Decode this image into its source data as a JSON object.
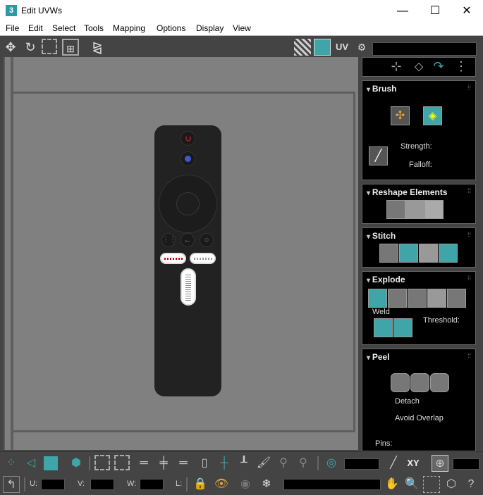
{
  "window": {
    "icon_text": "3",
    "title": "Edit UVWs",
    "minimize": "—",
    "maximize": "☐",
    "close": "✕"
  },
  "menu": [
    "File",
    "Edit",
    "Select",
    "Tools",
    "Mapping",
    "Options",
    "Display",
    "View"
  ],
  "toolbar": {
    "uv_label": "UV",
    "uv_value": ""
  },
  "panel": {
    "brush": {
      "title": "Brush",
      "strength_label": "Strength:",
      "falloff_label": "Falloff:"
    },
    "reshape": {
      "title": "Reshape Elements"
    },
    "stitch": {
      "title": "Stitch"
    },
    "explode": {
      "title": "Explode",
      "weld_label": "Weld",
      "threshold_label": "Threshold:"
    },
    "peel": {
      "title": "Peel",
      "detach_label": "Detach",
      "avoid_overlap_label": "Avoid Overlap",
      "pins_label": "Pins:"
    }
  },
  "bottom": {
    "xy_label": "XY",
    "u_label": "U:",
    "v_label": "V:",
    "w_label": "W:",
    "l_label": "L:",
    "u_value": "",
    "v_value": "",
    "w_value": "",
    "l_value": ""
  },
  "colors": {
    "accent": "#3fa5a8",
    "viewport": "#808080",
    "panel": "#000000"
  }
}
